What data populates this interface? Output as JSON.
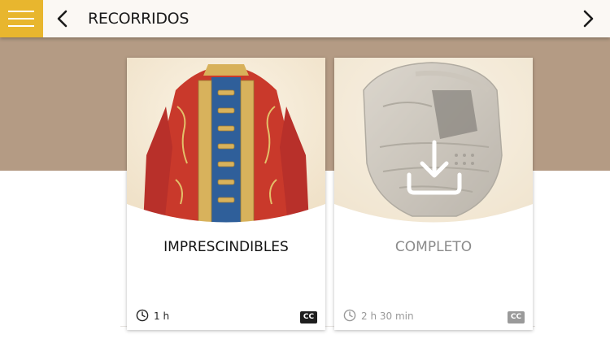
{
  "header": {
    "title": "RECORRIDOS",
    "menu_icon": "hamburger-menu-icon",
    "back_icon": "chevron-left-icon",
    "forward_icon": "chevron-right-icon"
  },
  "colors": {
    "accent": "#e8b62e",
    "band": "#b49b84",
    "header_bg": "#fbf8f4",
    "disabled_text": "#8a8a8a"
  },
  "tours": [
    {
      "title": "IMPRESCINDIBLES",
      "duration": "1 h",
      "captions_badge": "CC",
      "downloaded": true
    },
    {
      "title": "COMPLETO",
      "duration": "2 h 30 min",
      "captions_badge": "CC",
      "downloaded": false,
      "download_icon": "download-icon"
    }
  ]
}
